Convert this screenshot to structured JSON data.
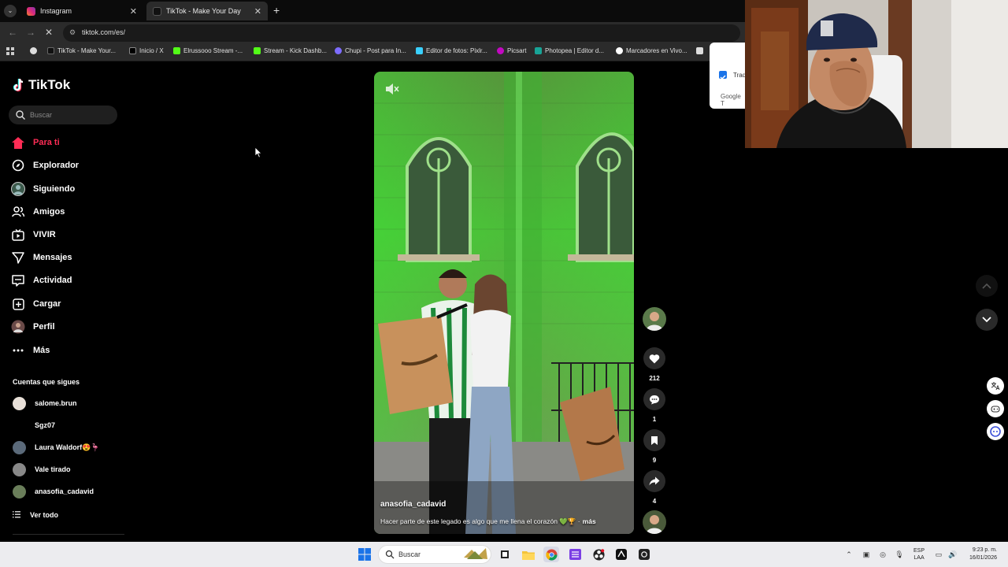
{
  "browser": {
    "tabs": [
      {
        "title": "Instagram",
        "icon": "instagram-icon",
        "active": false
      },
      {
        "title": "TikTok - Make Your Day",
        "icon": "tiktok-icon",
        "active": true
      }
    ],
    "url": "tiktok.com/es/",
    "bookmarks": [
      {
        "label": "TikTok - Make Your...",
        "icon": "tiktok-icon"
      },
      {
        "label": "Inicio / X",
        "icon": "x-icon"
      },
      {
        "label": "Elrussooo Stream -...",
        "icon": "kick-icon"
      },
      {
        "label": "Stream - Kick Dashb...",
        "icon": "kick-icon"
      },
      {
        "label": "Chupi - Post para In...",
        "icon": "heart-icon"
      },
      {
        "label": "Editor de fotos: Pixlr...",
        "icon": "pixlr-icon"
      },
      {
        "label": "Picsart",
        "icon": "picsart-icon"
      },
      {
        "label": "Photopea | Editor d...",
        "icon": "photopea-icon"
      },
      {
        "label": "Marcadores en Vivo...",
        "icon": "c-icon"
      }
    ]
  },
  "translate_popup": {
    "label": "Trad",
    "footer": "Google T"
  },
  "sidebar": {
    "logo": "TikTok",
    "search_placeholder": "Buscar",
    "nav": [
      {
        "label": "Para ti",
        "icon": "home-icon",
        "active": true
      },
      {
        "label": "Explorador",
        "icon": "compass-icon"
      },
      {
        "label": "Siguiendo",
        "icon": "following-avatar-icon"
      },
      {
        "label": "Amigos",
        "icon": "friends-icon"
      },
      {
        "label": "VIVIR",
        "icon": "live-icon"
      },
      {
        "label": "Mensajes",
        "icon": "messages-icon"
      },
      {
        "label": "Actividad",
        "icon": "activity-icon"
      },
      {
        "label": "Cargar",
        "icon": "upload-icon"
      },
      {
        "label": "Perfil",
        "icon": "profile-avatar-icon"
      },
      {
        "label": "Más",
        "icon": "more-icon"
      }
    ],
    "following_title": "Cuentas que sigues",
    "following": [
      {
        "name": "salome.brun",
        "avatar_color": "#e8e0d8"
      },
      {
        "name": "Sgz07",
        "avatar_color": ""
      },
      {
        "name": "Laura Waldorf😍🦩",
        "avatar_color": "#5b6a7a"
      },
      {
        "name": "Vale tirado",
        "avatar_color": "#888888"
      },
      {
        "name": "anasofia_cadavid",
        "avatar_color": "#6a7e5a"
      }
    ],
    "see_all": "Ver todo"
  },
  "video": {
    "author": "anasofia_cadavid",
    "caption": "Hacer parte de este legado es algo que me llena el corazón 💚🏆 ·",
    "more": "más"
  },
  "actions": {
    "likes": "212",
    "comments": "1",
    "saves": "9",
    "shares": "4"
  },
  "taskbar": {
    "search": "Buscar",
    "lang_line1": "ESP",
    "lang_line2": "LAA",
    "time": "9:23 p. m.",
    "date": "16/01/2026"
  },
  "colors": {
    "accent": "#fe2c55",
    "background": "#000000"
  }
}
